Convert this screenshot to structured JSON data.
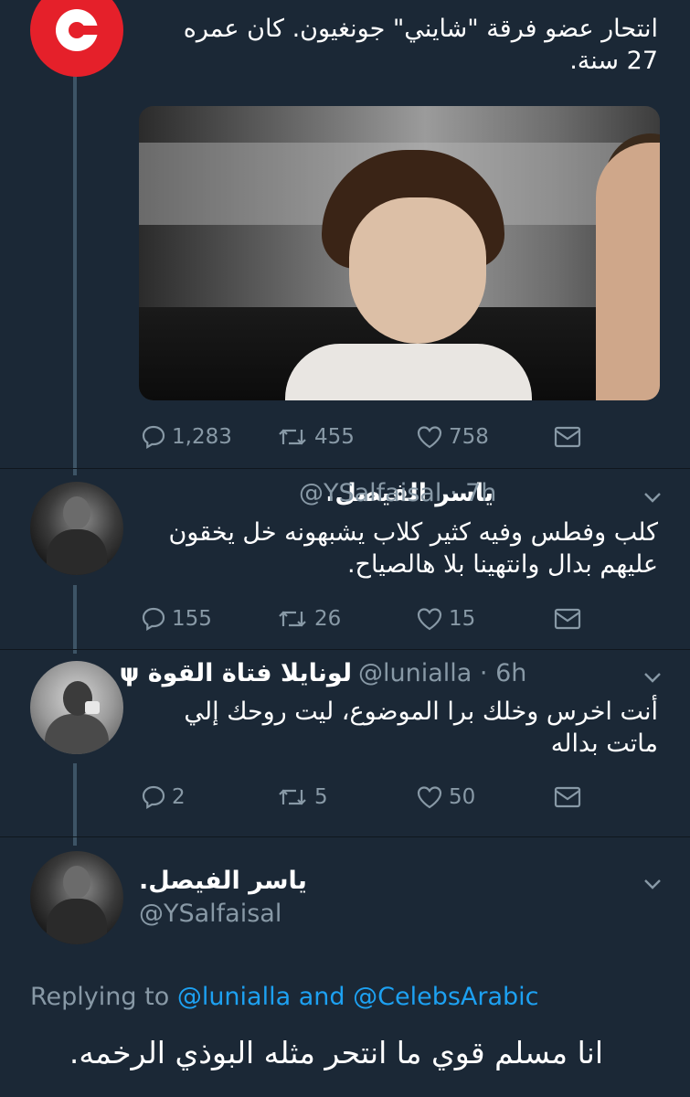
{
  "source_tweet": {
    "text": "انتحار عضو فرقة \"شايني\" جونغيون. كان عمره 27 سنة.",
    "actions": {
      "replies": "1,283",
      "retweets": "455",
      "likes": "758"
    }
  },
  "replies": [
    {
      "display_name": "ياسر الفيصل.",
      "handle": "@YSalfaisal",
      "time": "· 7h",
      "text": "كلب وفطس وفيه كثير كلاب يشبهونه خل يخقون عليهم بدال وانتهينا بلا هالصياح.",
      "actions": {
        "replies": "155",
        "retweets": "26",
        "likes": "15"
      }
    },
    {
      "display_name": "لونايلا فتاة القوة ψ",
      "handle": "@lunialla",
      "time": "· 6h",
      "text": "أنت اخرس وخلك برا الموضوع، ليت روحك إلي ماتت بداله",
      "actions": {
        "replies": "2",
        "retweets": "5",
        "likes": "50"
      }
    }
  ],
  "focused_tweet": {
    "display_name": "ياسر الفيصل.",
    "handle": "@YSalfaisal",
    "replying_prefix": "Replying to",
    "mention_1": "@lunialla",
    "and": "and",
    "mention_2": "@CelebsArabic",
    "text": "انا مسلم قوي ما انتحر مثله البوذي الرخمه."
  },
  "icons": {
    "reply": "reply-icon",
    "retweet": "retweet-icon",
    "like": "heart-icon",
    "dm": "envelope-icon",
    "more": "chevron-down-icon"
  },
  "colors": {
    "background": "#1b2836",
    "muted": "#8899a6",
    "link": "#1da1f2",
    "brand": "#e5202a"
  }
}
